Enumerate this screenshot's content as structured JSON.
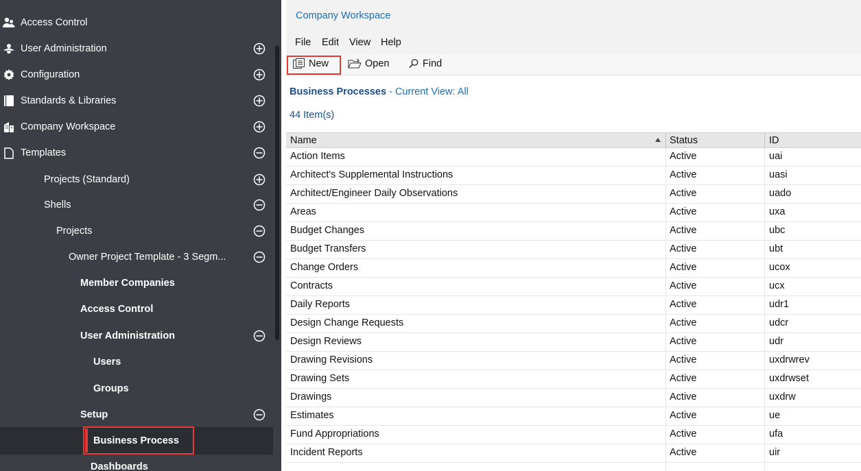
{
  "sidebar": {
    "items": [
      {
        "label": "Access Control",
        "icon": "people-icon",
        "toggle": ""
      },
      {
        "label": "User Administration",
        "icon": "user-admin-icon",
        "toggle": "expand"
      },
      {
        "label": "Configuration",
        "icon": "gear-icon",
        "toggle": "expand"
      },
      {
        "label": "Standards & Libraries",
        "icon": "book-icon",
        "toggle": "expand"
      },
      {
        "label": "Company Workspace",
        "icon": "building-icon",
        "toggle": "expand"
      },
      {
        "label": "Templates",
        "icon": "document-icon",
        "toggle": "collapse"
      },
      {
        "label": "Projects (Standard)",
        "icon": "",
        "toggle": "expand"
      },
      {
        "label": "Shells",
        "icon": "",
        "toggle": "collapse"
      },
      {
        "label": "Projects",
        "icon": "",
        "toggle": "collapse"
      },
      {
        "label": "Owner Project Template - 3 Segm...",
        "icon": "",
        "toggle": "collapse"
      },
      {
        "label": "Member Companies",
        "icon": "",
        "toggle": ""
      },
      {
        "label": "Access Control",
        "icon": "",
        "toggle": ""
      },
      {
        "label": "User Administration",
        "icon": "",
        "toggle": "collapse"
      },
      {
        "label": "Users",
        "icon": "",
        "toggle": ""
      },
      {
        "label": "Groups",
        "icon": "",
        "toggle": ""
      },
      {
        "label": "Setup",
        "icon": "",
        "toggle": "collapse"
      },
      {
        "label": "Business Process",
        "icon": "",
        "toggle": ""
      },
      {
        "label": "Dashboards",
        "icon": "",
        "toggle": ""
      }
    ],
    "selected": "Business Process"
  },
  "breadcrumb": "Company Workspace",
  "menu": [
    "File",
    "Edit",
    "View",
    "Help"
  ],
  "toolbar": {
    "new": "New",
    "open": "Open",
    "find": "Find"
  },
  "section": {
    "title": "Business Processes",
    "view": "- Current View:  All"
  },
  "count": "44  Item(s)",
  "table": {
    "columns": [
      "Name",
      "Status",
      "ID"
    ],
    "sort": "Name ascending",
    "rows": [
      [
        "Action Items",
        "Active",
        "uai"
      ],
      [
        "Architect's Supplemental Instructions",
        "Active",
        "uasi"
      ],
      [
        "Architect/Engineer Daily Observations",
        "Active",
        "uado"
      ],
      [
        "Areas",
        "Active",
        "uxa"
      ],
      [
        "Budget Changes",
        "Active",
        "ubc"
      ],
      [
        "Budget Transfers",
        "Active",
        "ubt"
      ],
      [
        "Change Orders",
        "Active",
        "ucox"
      ],
      [
        "Contracts",
        "Active",
        "ucx"
      ],
      [
        "Daily Reports",
        "Active",
        "udr1"
      ],
      [
        "Design Change Requests",
        "Active",
        "udcr"
      ],
      [
        "Design Reviews",
        "Active",
        "udr"
      ],
      [
        "Drawing Revisions",
        "Active",
        "uxdrwrev"
      ],
      [
        "Drawing Sets",
        "Active",
        "uxdrwset"
      ],
      [
        "Drawings",
        "Active",
        "uxdrw"
      ],
      [
        "Estimates",
        "Active",
        "ue"
      ],
      [
        "Fund Appropriations",
        "Active",
        "ufa"
      ],
      [
        "Incident Reports",
        "Active",
        "uir"
      ]
    ]
  },
  "colors": {
    "sidebar": "#3b3e45",
    "highlight": "#e53935",
    "link": "#1b6fb5"
  }
}
